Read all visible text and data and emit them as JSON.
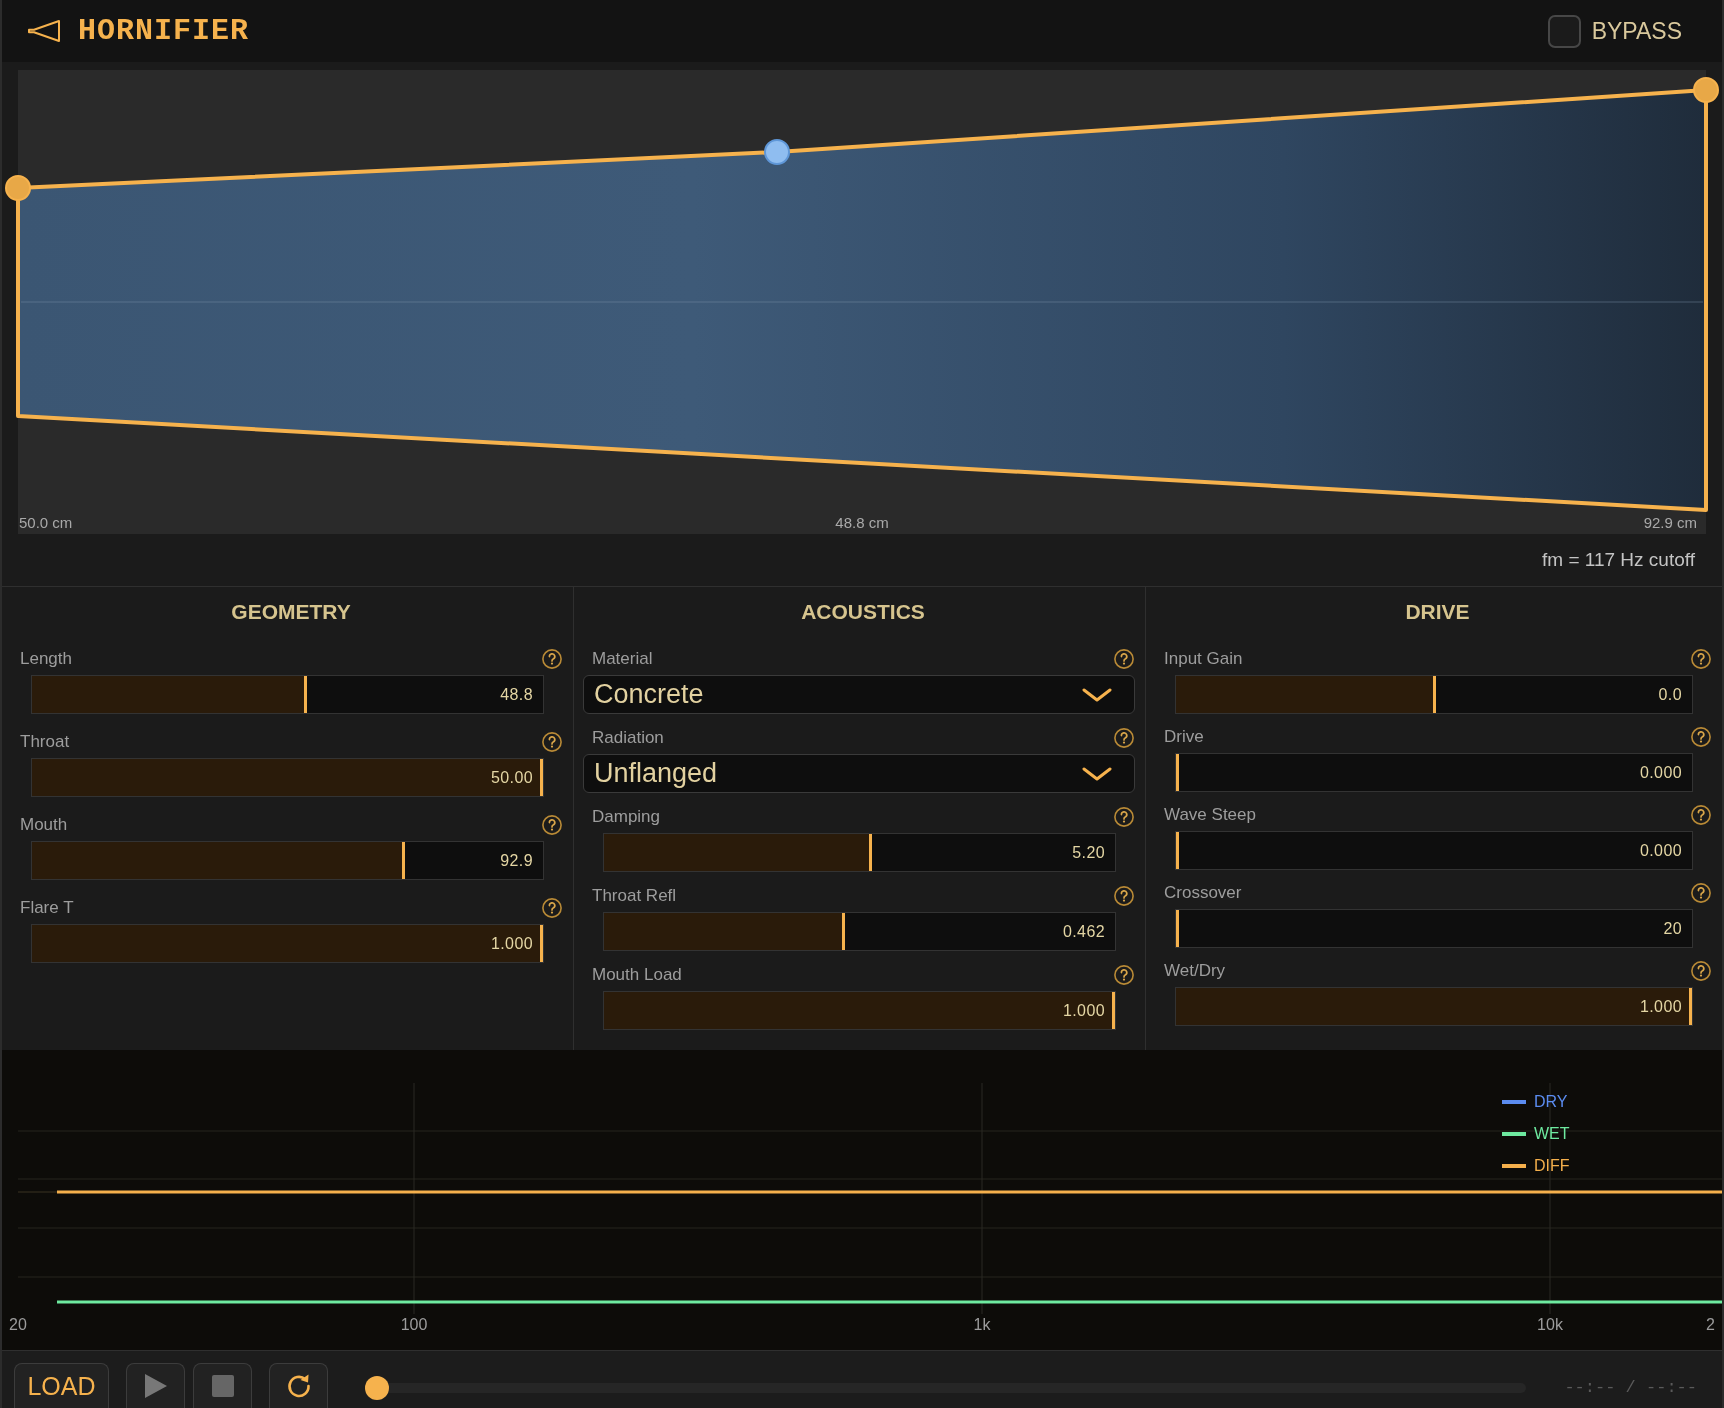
{
  "header": {
    "title": "HORNIFIER",
    "bypass": {
      "label": "BYPASS",
      "checked": false
    }
  },
  "horn_display": {
    "throat_label": "50.0 cm",
    "length_label": "48.8 cm",
    "mouth_label": "92.9 cm",
    "cutoff": "fm = 117 Hz cutoff"
  },
  "panels": [
    {
      "title": "GEOMETRY",
      "controls": [
        {
          "kind": "slider",
          "label": "Length",
          "value": "48.8",
          "level": 0.536
        },
        {
          "kind": "slider",
          "label": "Throat",
          "value": "50.00",
          "level": 1
        },
        {
          "kind": "slider",
          "label": "Mouth",
          "value": "92.9",
          "level": 0.729
        },
        {
          "kind": "slider",
          "label": "Flare T",
          "value": "1.000",
          "level": 1
        }
      ]
    },
    {
      "title": "ACOUSTICS",
      "controls": [
        {
          "kind": "dropdown",
          "label": "Material",
          "value": "Concrete"
        },
        {
          "kind": "dropdown",
          "label": "Radiation",
          "value": "Unflanged"
        },
        {
          "kind": "slider",
          "label": "Damping",
          "value": "5.20",
          "level": 0.521
        },
        {
          "kind": "slider",
          "label": "Throat Refl",
          "value": "0.462",
          "level": 0.468
        },
        {
          "kind": "slider",
          "label": "Mouth Load",
          "value": "1.000",
          "level": 1
        }
      ]
    },
    {
      "title": "DRIVE",
      "controls": [
        {
          "kind": "slider",
          "label": "Input Gain",
          "value": "0.0",
          "level": 0.5
        },
        {
          "kind": "slider",
          "label": "Drive",
          "value": "0.000",
          "level": 0
        },
        {
          "kind": "slider",
          "label": "Wave Steep",
          "value": "0.000",
          "level": 0
        },
        {
          "kind": "slider",
          "label": "Crossover",
          "value": "20",
          "level": 0
        },
        {
          "kind": "slider",
          "label": "Wet/Dry",
          "value": "1.000",
          "level": 1
        }
      ]
    }
  ],
  "response_chart": {
    "legend": [
      {
        "name": "DRY",
        "color": "#5b8cf0"
      },
      {
        "name": "WET",
        "color": "#6eeaa0"
      },
      {
        "name": "DIFF",
        "color": "#f5b04c"
      }
    ],
    "x_ticks": [
      "20",
      "100",
      "1k",
      "10k",
      "2"
    ]
  },
  "transport": {
    "buttons": [
      {
        "kind": "load",
        "label": "LOAD"
      },
      {
        "kind": "play"
      },
      {
        "kind": "stop"
      },
      {
        "kind": "loop"
      }
    ],
    "position": {
      "level": 0
    },
    "time": "--:-- / --:--"
  }
}
